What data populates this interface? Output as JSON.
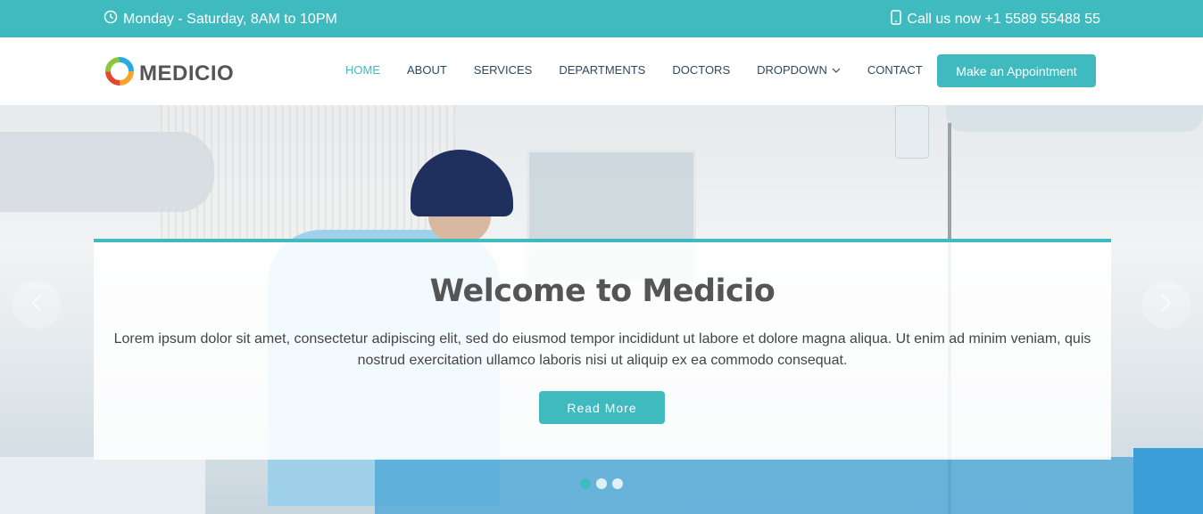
{
  "topbar": {
    "hours": "Monday - Saturday, 8AM to 10PM",
    "phone": "Call us now +1 5589 55488 55",
    "hours_icon": "clock-icon",
    "phone_icon": "phone-icon"
  },
  "header": {
    "logo_text": "MEDICIO",
    "nav": [
      {
        "label": "HOME"
      },
      {
        "label": "ABOUT"
      },
      {
        "label": "SERVICES"
      },
      {
        "label": "DEPARTMENTS"
      },
      {
        "label": "DOCTORS"
      },
      {
        "label": "DROPDOWN"
      },
      {
        "label": "CONTACT"
      }
    ],
    "active_nav": "HOME",
    "appointment_button": "Make an Appointment"
  },
  "hero": {
    "title": "Welcome to Medicio",
    "text": "Lorem ipsum dolor sit amet, consectetur adipiscing elit, sed do eiusmod tempor incididunt ut labore et dolore magna aliqua. Ut enim ad minim veniam, quis nostrud exercitation ullamco laboris nisi ut aliquip ex ea commodo consequat.",
    "button": "Read More",
    "slide_count": 3,
    "active_slide": 1
  },
  "colors": {
    "accent": "#3fbbc0",
    "nav_text": "#2c4964"
  }
}
